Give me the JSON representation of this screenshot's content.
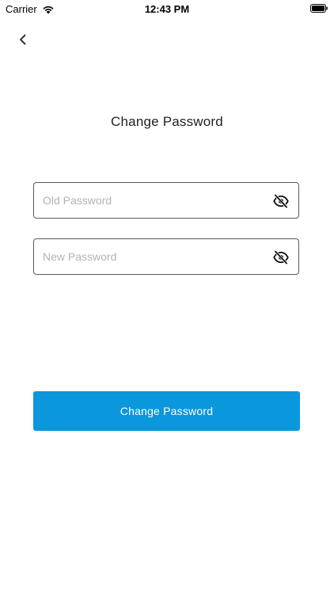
{
  "status_bar": {
    "carrier": "Carrier",
    "time": "12:43 PM",
    "icons": [
      "wifi-icon",
      "battery-icon"
    ]
  },
  "nav": {
    "back_icon": "chevron-left-icon"
  },
  "page": {
    "title": "Change Password"
  },
  "form": {
    "old_password": {
      "placeholder": "Old Password",
      "value": "",
      "icon": "eye-off-icon"
    },
    "new_password": {
      "placeholder": "New Password",
      "value": "",
      "icon": "eye-off-icon"
    },
    "submit_label": "Change Password"
  },
  "colors": {
    "accent": "#0b97dc",
    "border": "#5a5a5a",
    "placeholder": "#b3b3b3"
  }
}
